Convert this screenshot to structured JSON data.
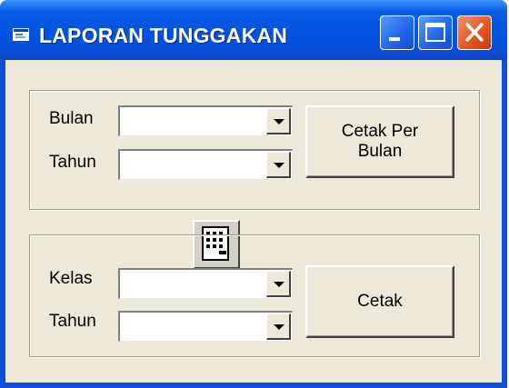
{
  "window": {
    "title": "LAPORAN TUNGGAKAN"
  },
  "titlebar_buttons": {
    "minimize": "minimize-icon",
    "maximize": "maximize-icon",
    "close": "close-icon"
  },
  "group_month": {
    "bulan_label": "Bulan",
    "bulan_value": "",
    "tahun_label": "Tahun",
    "tahun_value": "",
    "button_label": "Cetak Per\nBulan"
  },
  "group_class": {
    "kelas_label": "Kelas",
    "kelas_value": "",
    "tahun_label": "Tahun",
    "tahun_value": "",
    "button_label": "Cetak"
  },
  "icons": {
    "title_icon": "form-icon",
    "center_icon": "calculator-icon"
  },
  "colors": {
    "titlebar": "#0a50d8",
    "client": "#ece9d8",
    "close_button": "#e3531e"
  }
}
